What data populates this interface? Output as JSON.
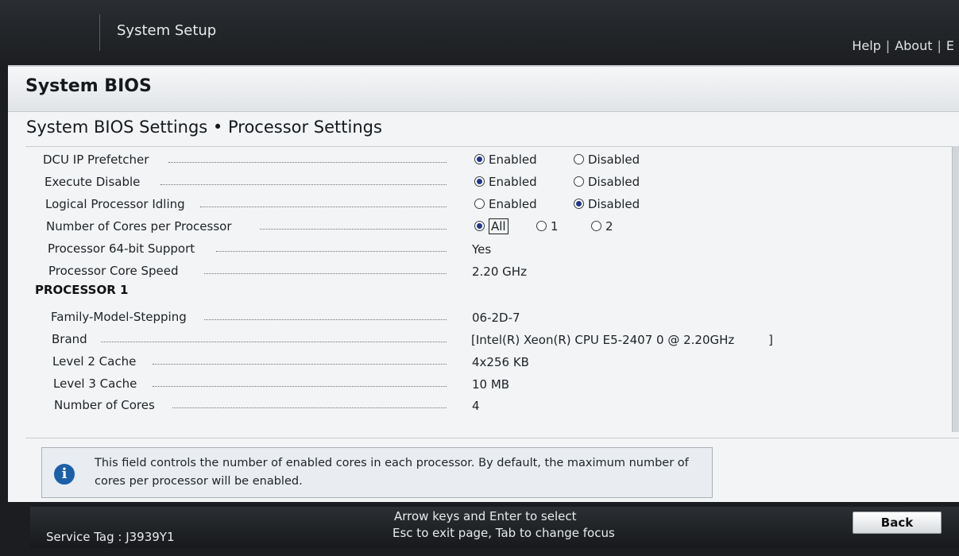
{
  "header": {
    "app_title": "System Setup",
    "links": [
      "Help",
      "About",
      "E"
    ]
  },
  "panel": {
    "title": "System BIOS",
    "breadcrumb": "System BIOS Settings • Processor Settings"
  },
  "settings": [
    {
      "label": "DCU IP Prefetcher",
      "options": [
        "Enabled",
        "Disabled"
      ],
      "selected": "Enabled"
    },
    {
      "label": "Execute Disable",
      "options": [
        "Enabled",
        "Disabled"
      ],
      "selected": "Enabled"
    },
    {
      "label": "Logical Processor Idling",
      "options": [
        "Enabled",
        "Disabled"
      ],
      "selected": "Disabled"
    },
    {
      "label": "Number of Cores per Processor",
      "options": [
        "All",
        "1",
        "2"
      ],
      "selected": "All"
    },
    {
      "label": "Processor 64-bit Support",
      "value": "Yes"
    },
    {
      "label": "Processor Core Speed",
      "value": "2.20 GHz"
    }
  ],
  "processor_section": {
    "title": "PROCESSOR 1",
    "rows": [
      {
        "label": "Family-Model-Stepping",
        "value": "06-2D-7"
      },
      {
        "label": "Brand",
        "value": "[Intel(R) Xeon(R) CPU E5-2407 0 @ 2.20GHz",
        "suffix": "]"
      },
      {
        "label": "Level 2 Cache",
        "value": "4x256 KB"
      },
      {
        "label": "Level 3 Cache",
        "value": "10 MB"
      },
      {
        "label": "Number of Cores",
        "value": "4"
      }
    ]
  },
  "help": {
    "icon": "info-icon",
    "text": "This field controls the number of enabled cores in each processor. By default, the maximum number of cores per processor will be enabled."
  },
  "footer": {
    "service_tag": "Service Tag : J3939Y1",
    "hint_line1": "Arrow keys and Enter to select",
    "hint_line2": "Esc to exit page, Tab to change focus",
    "back_label": "Back"
  },
  "colors": {
    "radio_selected": "#23368a",
    "info_icon": "#1b5fa8",
    "panel_bg": "#f2f4f5",
    "bar_bg": "#1a1c1f"
  }
}
